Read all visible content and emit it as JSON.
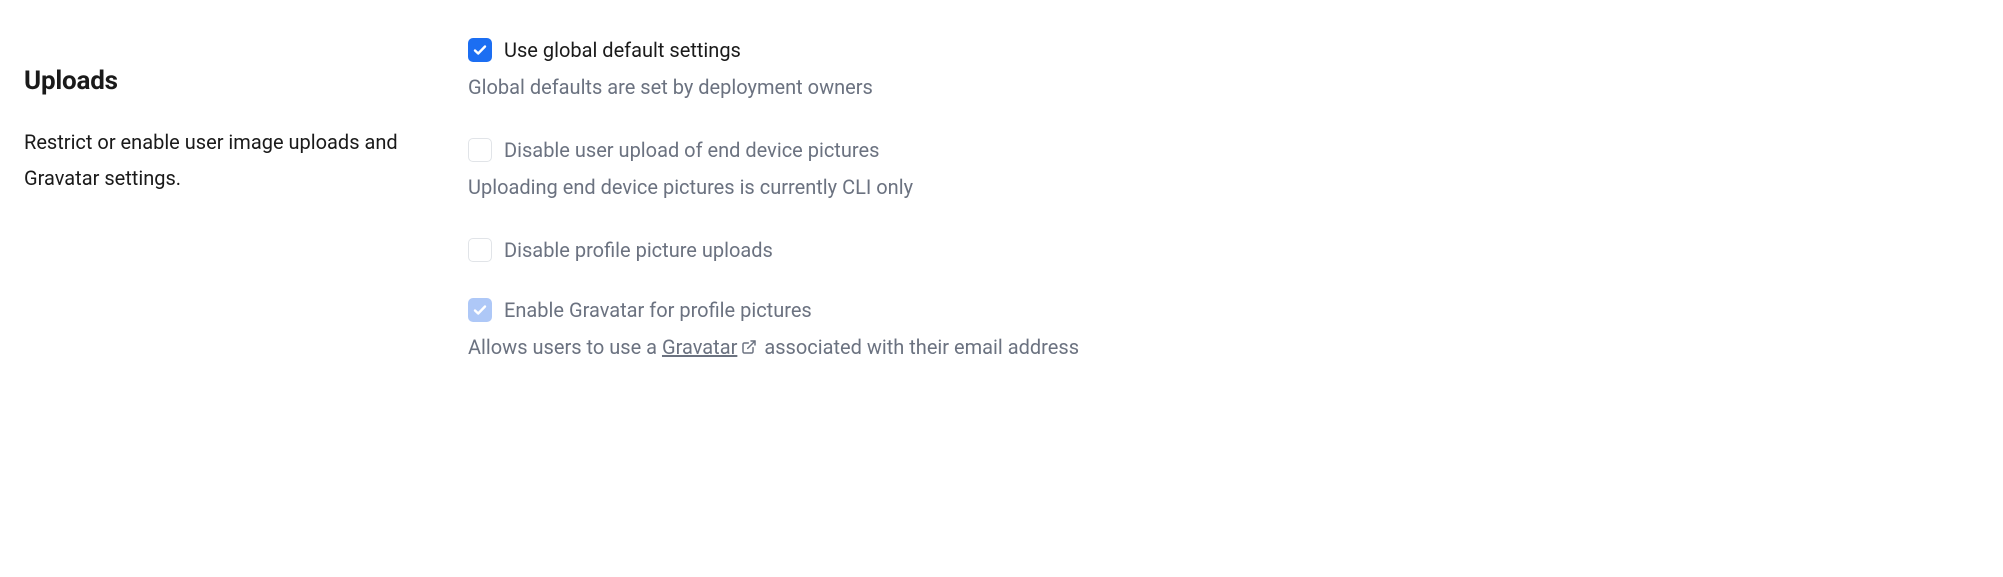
{
  "section": {
    "title": "Uploads",
    "description": "Restrict or enable user image uploads and Gravatar settings."
  },
  "options": {
    "use_global_defaults": {
      "label": "Use global default settings",
      "help": "Global defaults are set by deployment owners"
    },
    "disable_device_pictures": {
      "label": "Disable user upload of end device pictures",
      "help": "Uploading end device pictures is currently CLI only"
    },
    "disable_profile_pictures": {
      "label": "Disable profile picture uploads"
    },
    "enable_gravatar": {
      "label": "Enable Gravatar for profile pictures",
      "help_prefix": "Allows users to use a ",
      "help_link_text": "Gravatar",
      "help_suffix": " associated with their email address"
    }
  }
}
